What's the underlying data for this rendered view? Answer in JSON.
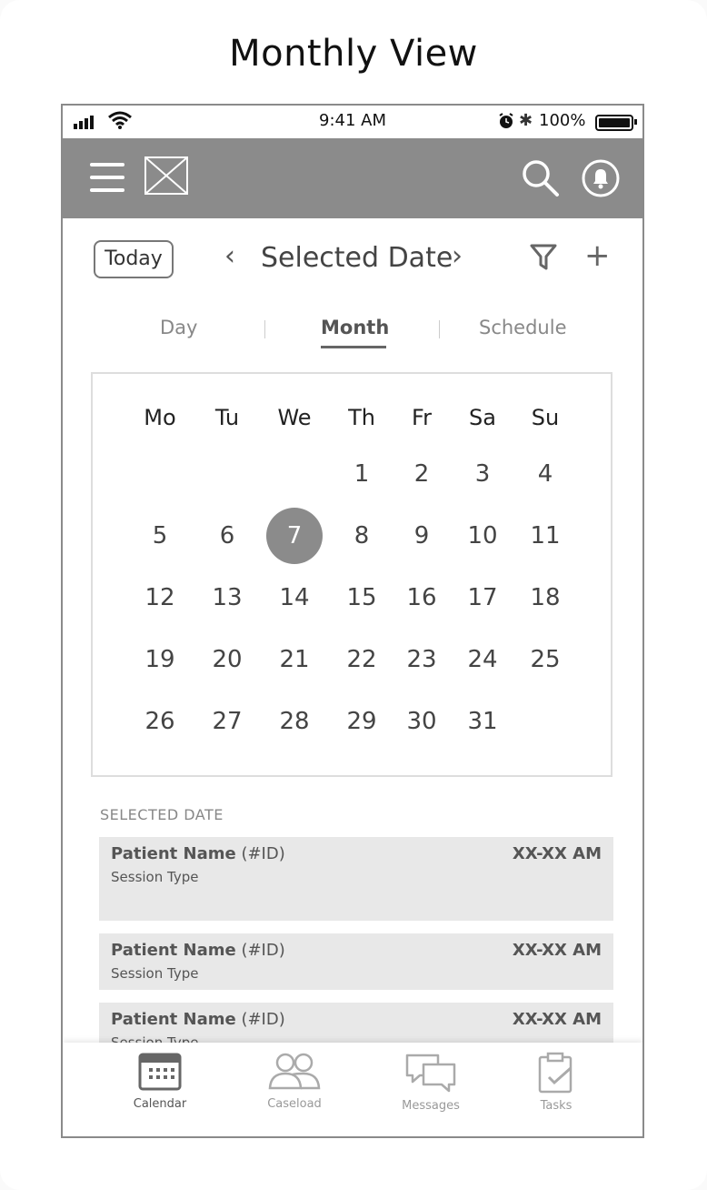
{
  "page_title": "Monthly View",
  "status_bar": {
    "time": "9:41 AM",
    "battery": "100%"
  },
  "toolbar": {
    "today_label": "Today",
    "prev": "‹",
    "selected_date": "Selected Date",
    "next": "›",
    "add": "+"
  },
  "tabs": [
    {
      "label": "Day",
      "active": false
    },
    {
      "label": "Month",
      "active": true
    },
    {
      "label": "Schedule",
      "active": false
    }
  ],
  "calendar": {
    "weekdays": [
      "Mo",
      "Tu",
      "We",
      "Th",
      "Fr",
      "Sa",
      "Su"
    ],
    "weeks": [
      [
        "",
        "",
        "",
        "1",
        "2",
        "3",
        "4"
      ],
      [
        "5",
        "6",
        "7",
        "8",
        "9",
        "10",
        "11"
      ],
      [
        "12",
        "13",
        "14",
        "15",
        "16",
        "17",
        "18"
      ],
      [
        "19",
        "20",
        "21",
        "22",
        "23",
        "24",
        "25"
      ],
      [
        "26",
        "27",
        "28",
        "29",
        "30",
        "31",
        ""
      ]
    ],
    "selected_day": "7"
  },
  "list": {
    "section_label": "SELECTED DATE",
    "appointments": [
      {
        "patient": "Patient Name",
        "id": "(#ID)",
        "session": "Session Type",
        "time": "XX-XX AM"
      },
      {
        "patient": "Patient Name",
        "id": "(#ID)",
        "session": "Session Type",
        "time": "XX-XX AM"
      },
      {
        "patient": "Patient Name",
        "id": "(#ID)",
        "session": "Session Type",
        "time": "XX-XX AM"
      }
    ]
  },
  "bottom_nav": [
    {
      "label": "Calendar",
      "icon": "calendar-icon",
      "active": true
    },
    {
      "label": "Caseload",
      "icon": "people-icon",
      "active": false
    },
    {
      "label": "Messages",
      "icon": "chat-icon",
      "active": false
    },
    {
      "label": "Tasks",
      "icon": "clipboard-check-icon",
      "active": false
    }
  ],
  "colors": {
    "app_bar": "#8b8b8b",
    "selected_day": "#8b8b8b",
    "list_row": "#e8e8e8"
  }
}
